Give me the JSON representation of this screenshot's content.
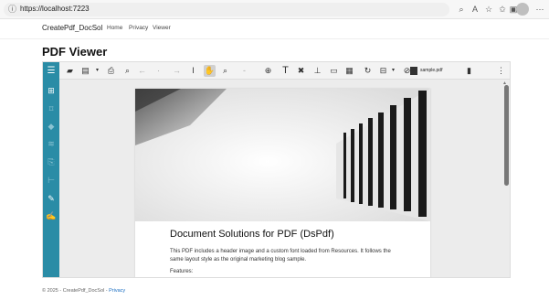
{
  "browser": {
    "url": "https://localhost:7223",
    "icons": [
      "info-icon",
      "search-icon",
      "read-aloud-icon",
      "favorite-icon",
      "favorites-bar-icon",
      "collections-icon",
      "profile-avatar",
      "more-icon"
    ]
  },
  "nav": {
    "brand": "CreatePdf_DocSol",
    "links": [
      "Home",
      "Privacy",
      "Viewer"
    ]
  },
  "page_title": "PDF Viewer",
  "viewer": {
    "document_name": "sample.pdf",
    "accent_color": "#2a8ca6"
  },
  "document": {
    "title": "Document Solutions for PDF (DsPdf)",
    "paragraph": "This PDF includes a header image and a custom font loaded from Resources. It follows the same layout style as the original marketing blog sample.",
    "features_label": "Features:"
  },
  "footer": {
    "text": "© 2025 - CreatePdf_DocSol -",
    "link": "Privacy"
  }
}
